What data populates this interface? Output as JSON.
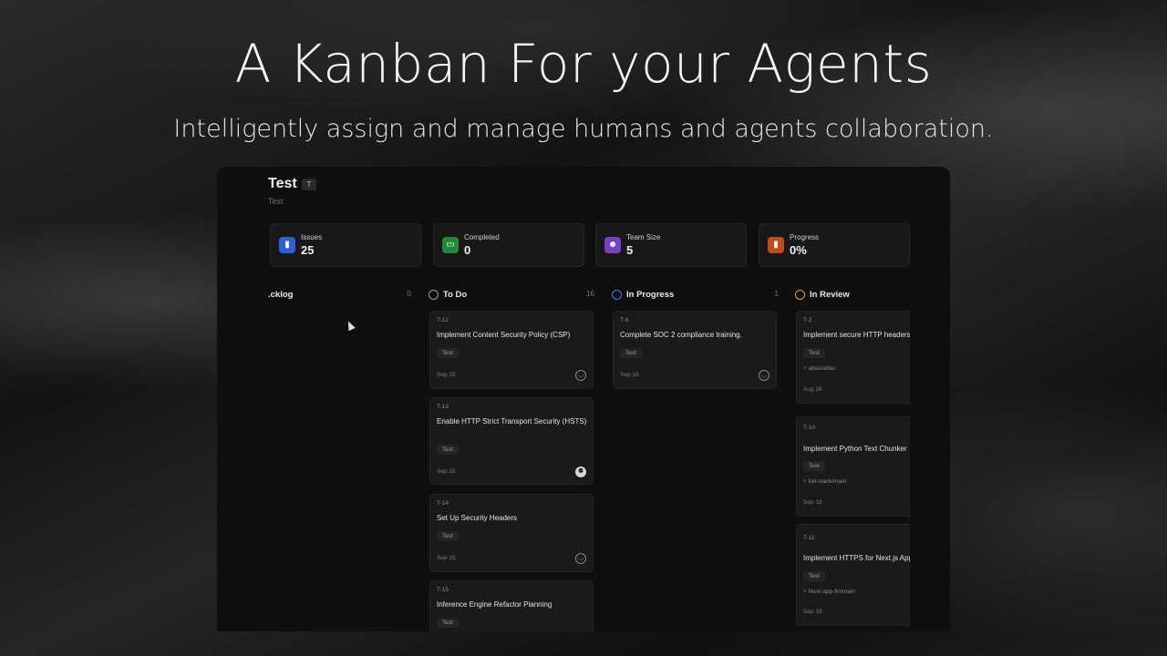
{
  "hero": {
    "title": "A Kanban For your Agents",
    "subtitle": "Intelligently assign and manage humans and agents collaboration."
  },
  "project": {
    "title": "Test",
    "key": "T",
    "description": "Test"
  },
  "stats": [
    {
      "label": "Issues",
      "value": "25",
      "icon": "chart-icon",
      "color": "#2f5fd0"
    },
    {
      "label": "Completed",
      "value": "0",
      "icon": "calendar-icon",
      "color": "#1f8a3b"
    },
    {
      "label": "Team Size",
      "value": "5",
      "icon": "users-icon",
      "color": "#7b3fc4"
    },
    {
      "label": "Progress",
      "value": "0%",
      "icon": "chart-icon",
      "color": "#c2491d"
    }
  ],
  "columns": [
    {
      "name": ".cklog",
      "count": "0",
      "ring_color": "#666666"
    },
    {
      "name": "To Do",
      "count": "16",
      "ring_color": "#9a9a9a"
    },
    {
      "name": "In Progress",
      "count": "1",
      "ring_color": "#3b82f6"
    },
    {
      "name": "In Review",
      "count": "",
      "ring_color": "#f0a020"
    }
  ],
  "todo_cards": [
    {
      "id": "T-12",
      "title": "Implement Content Security Policy (CSP)",
      "tag": "Test",
      "date": "Sep 15"
    },
    {
      "id": "T-13",
      "title": "Enable HTTP Strict Transport Security (HSTS)",
      "tag": "Test",
      "date": "Sep 15"
    },
    {
      "id": "T-14",
      "title": "Set Up Security Headers",
      "tag": "Test",
      "date": "Sep 15"
    },
    {
      "id": "T-15",
      "title": "Inference Engine Refactor Planning",
      "tag": "Test",
      "date": ""
    }
  ],
  "inprogress_cards": [
    {
      "id": "T-8",
      "title": "Complete SOC 2 compliance training.",
      "tag": "Test",
      "date": "Sep 18"
    }
  ],
  "review_cards": [
    {
      "id": "T-3",
      "title": "Implement secure HTTP headers",
      "tag": "Test",
      "branch": "atlas/atlas",
      "date": "Aug 26"
    },
    {
      "id": "T-10",
      "title": "Implement Python Text Chunker",
      "tag": "Test",
      "branch": "full-stack/main",
      "date": "Sep 18"
    },
    {
      "id": "T-11",
      "title": "Implement HTTPS for Next.js App",
      "tag": "Test",
      "branch": "Next-app-fin/main",
      "date": "Sep 18"
    }
  ]
}
